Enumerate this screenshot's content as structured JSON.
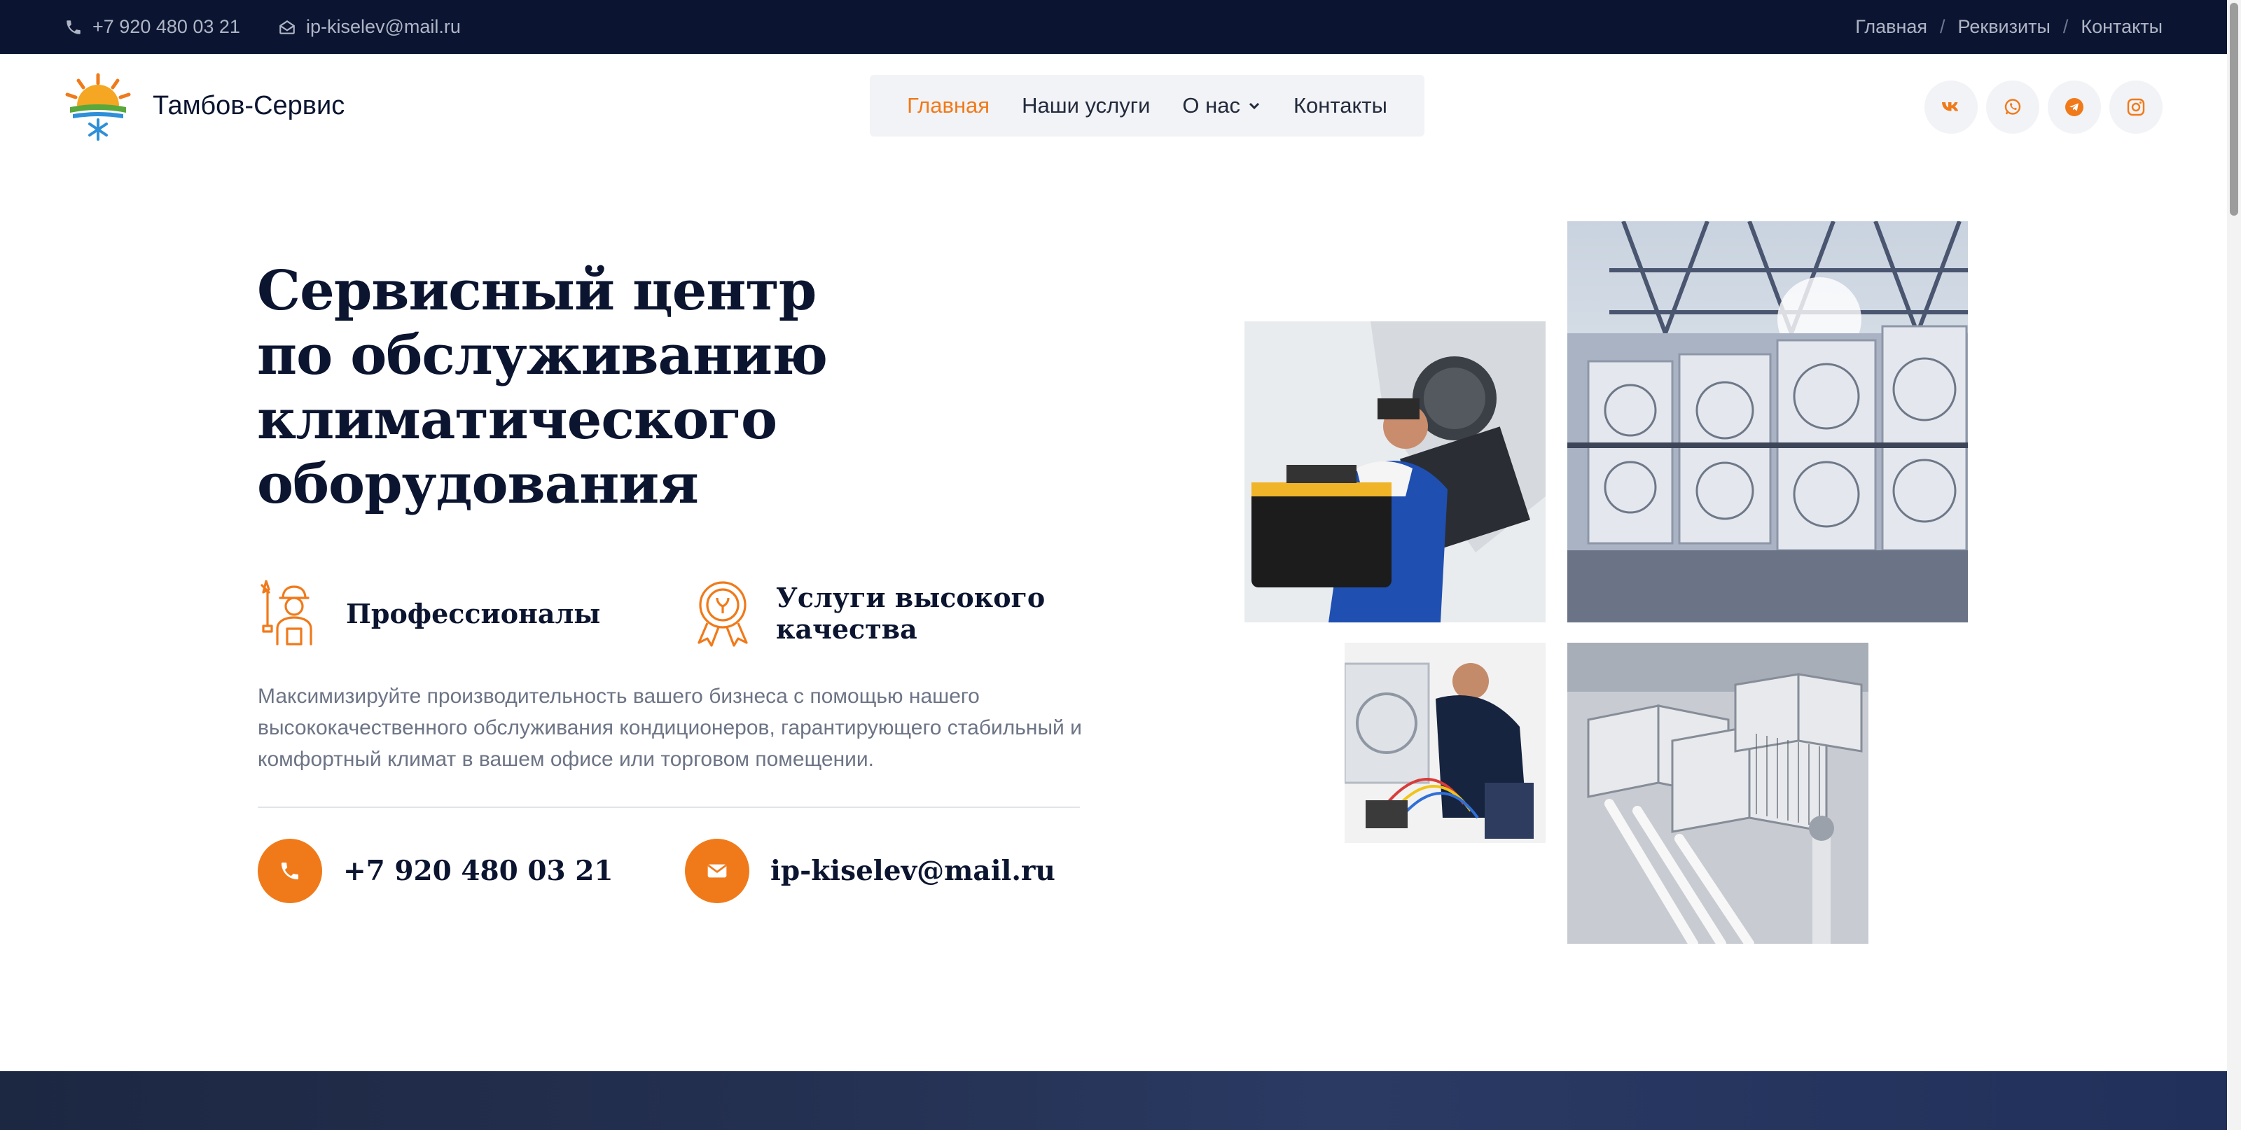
{
  "topbar": {
    "phone": "+7 920 480 03 21",
    "email": "ip-kiselev@mail.ru",
    "breadcrumbs": [
      "Главная",
      "Реквизиты",
      "Контакты"
    ],
    "separator": "/"
  },
  "header": {
    "logo_text": "Тамбов-Сервис",
    "nav": [
      {
        "label": "Главная",
        "active": true
      },
      {
        "label": "Наши услуги",
        "active": false
      },
      {
        "label": "О нас",
        "active": false,
        "dropdown": true
      },
      {
        "label": "Контакты",
        "active": false
      }
    ],
    "socials": [
      {
        "icon": "vk-icon"
      },
      {
        "icon": "whatsapp-icon"
      },
      {
        "icon": "telegram-icon"
      },
      {
        "icon": "instagram-icon"
      }
    ]
  },
  "hero": {
    "title": "Сервисный центр по обслуживанию климатического оборудования",
    "features": [
      {
        "icon": "worker-icon",
        "label": "Профессионалы"
      },
      {
        "icon": "quality-badge-icon",
        "label": "Услуги высокого качества"
      }
    ],
    "description": "Максимизируйте производительность вашего бизнеса с помощью нашего высококачественного обслуживания кондиционеров, гарантирующего стабильный и комфортный климат в вашем офисе или торговом помещении.",
    "phone": "+7 920 480 03 21",
    "email": "ip-kiselev@mail.ru"
  },
  "colors": {
    "accent": "#f07a1a",
    "dark": "#0b1532",
    "text_muted": "#6c7485",
    "nav_bg": "#f2f3f6"
  }
}
